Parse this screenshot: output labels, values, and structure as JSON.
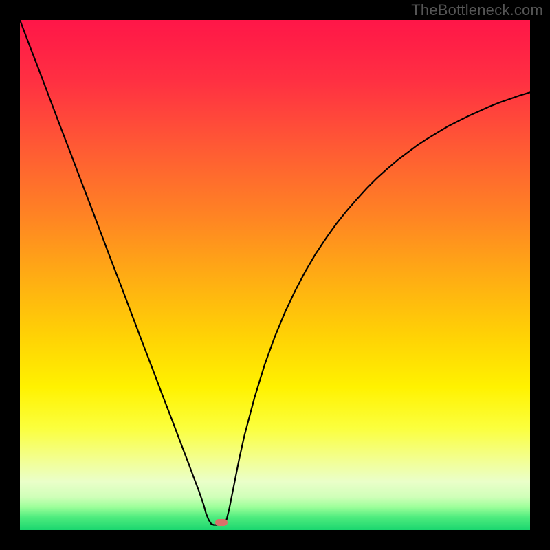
{
  "watermark": "TheBottleneck.com",
  "colors": {
    "gradient_stops": [
      {
        "offset": 0.0,
        "color": "#ff1648"
      },
      {
        "offset": 0.12,
        "color": "#ff3042"
      },
      {
        "offset": 0.25,
        "color": "#ff5a34"
      },
      {
        "offset": 0.38,
        "color": "#ff8224"
      },
      {
        "offset": 0.5,
        "color": "#ffab14"
      },
      {
        "offset": 0.62,
        "color": "#ffd205"
      },
      {
        "offset": 0.72,
        "color": "#fff200"
      },
      {
        "offset": 0.8,
        "color": "#fbff3d"
      },
      {
        "offset": 0.86,
        "color": "#f3ff8f"
      },
      {
        "offset": 0.905,
        "color": "#eaffc9"
      },
      {
        "offset": 0.935,
        "color": "#d0ffb9"
      },
      {
        "offset": 0.955,
        "color": "#9cff9a"
      },
      {
        "offset": 0.975,
        "color": "#4eec7e"
      },
      {
        "offset": 1.0,
        "color": "#1ad66f"
      }
    ],
    "curve": "#000000",
    "marker": "#d9716a",
    "background": "#000000"
  },
  "chart_data": {
    "type": "line",
    "title": "",
    "xlabel": "",
    "ylabel": "",
    "xlim": [
      0,
      100
    ],
    "ylim": [
      0,
      100
    ],
    "notch": {
      "x": 38,
      "flat_width": 3
    },
    "marker": {
      "x": 39.5,
      "y": 1.5
    },
    "series": [
      {
        "name": "bottleneck-curve",
        "x": [
          0,
          2,
          4,
          6,
          8,
          10,
          12,
          14,
          16,
          18,
          20,
          22,
          24,
          26,
          28,
          30,
          32,
          33,
          34,
          35,
          36,
          36.5,
          37,
          37.5,
          38,
          39,
          40,
          40.5,
          41,
          42,
          43,
          44,
          46,
          48,
          50,
          52,
          54,
          56,
          58,
          60,
          62,
          64,
          66,
          68,
          70,
          72,
          74,
          76,
          78,
          80,
          82,
          84,
          86,
          88,
          90,
          92,
          94,
          96,
          98,
          100
        ],
        "y": [
          100,
          94.7,
          89.5,
          84.2,
          78.9,
          73.7,
          68.4,
          63.2,
          57.9,
          52.6,
          47.4,
          42.1,
          36.8,
          31.6,
          26.3,
          21.1,
          15.8,
          13.2,
          10.5,
          7.9,
          5.0,
          3.2,
          2.0,
          1.2,
          1.0,
          1.0,
          1.2,
          2.0,
          4.0,
          9.0,
          14.0,
          18.5,
          26.0,
          32.5,
          38.0,
          42.8,
          47.0,
          50.8,
          54.2,
          57.2,
          60.0,
          62.5,
          64.8,
          67.0,
          69.0,
          70.8,
          72.5,
          74.0,
          75.5,
          76.8,
          78.0,
          79.2,
          80.2,
          81.2,
          82.1,
          83.0,
          83.8,
          84.5,
          85.2,
          85.8
        ]
      }
    ]
  }
}
